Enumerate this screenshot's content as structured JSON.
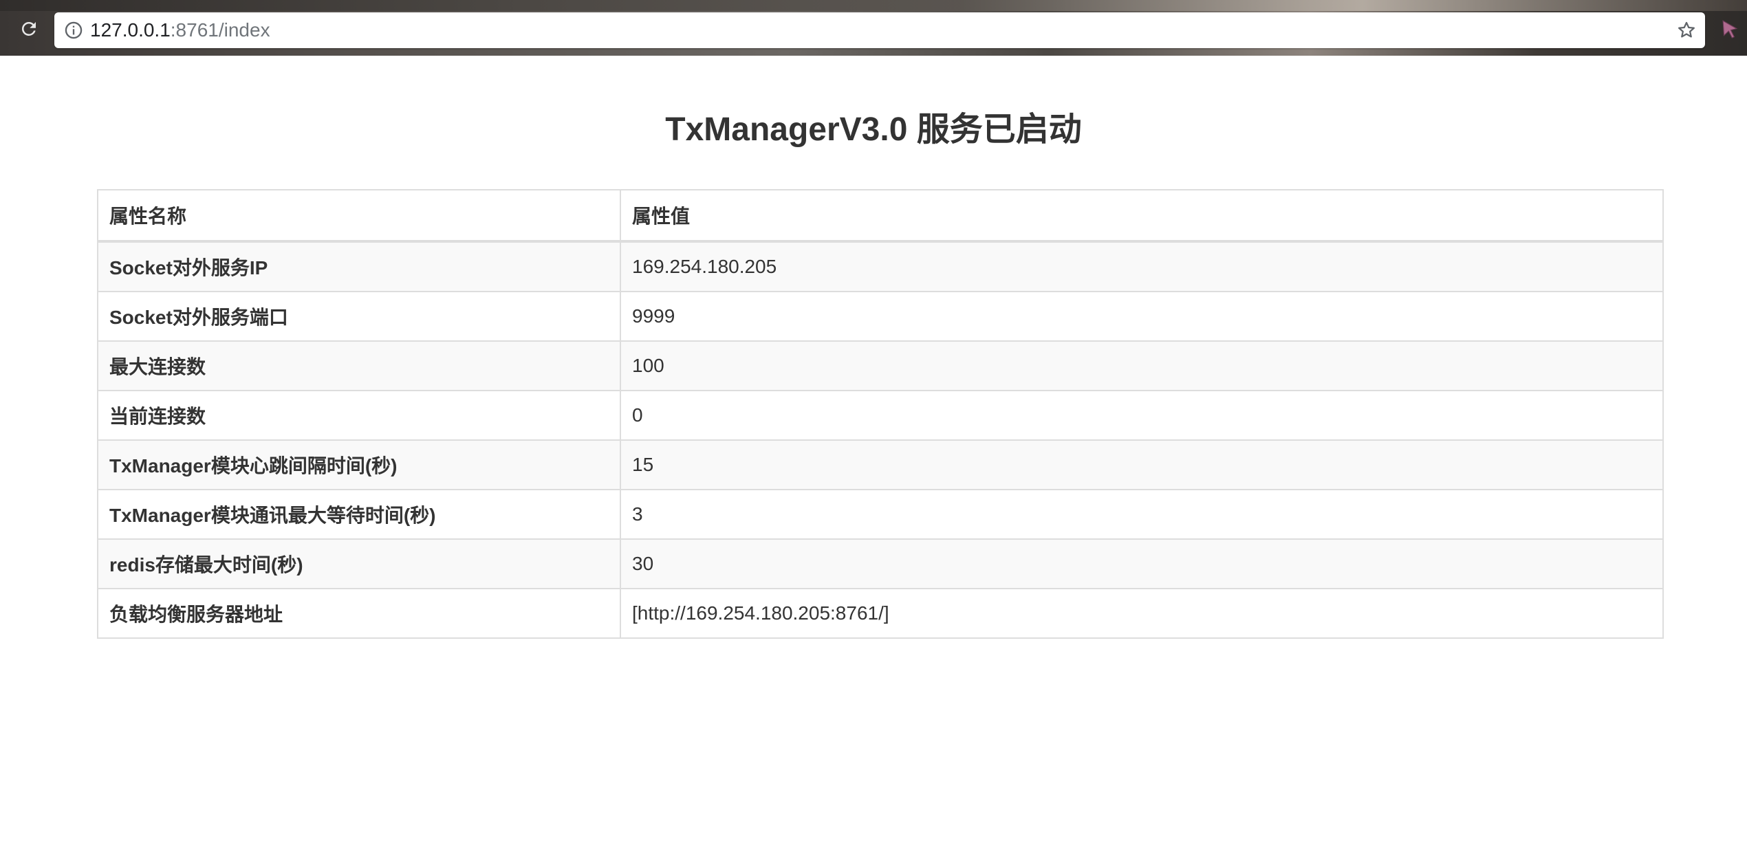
{
  "browser": {
    "url_host": "127.0.0.1",
    "url_rest": ":8761/index"
  },
  "page": {
    "title": "TxManagerV3.0 服务已启动"
  },
  "table": {
    "headers": [
      "属性名称",
      "属性值"
    ],
    "rows": [
      {
        "name": "Socket对外服务IP",
        "value": "169.254.180.205"
      },
      {
        "name": "Socket对外服务端口",
        "value": "9999"
      },
      {
        "name": "最大连接数",
        "value": "100"
      },
      {
        "name": "当前连接数",
        "value": "0"
      },
      {
        "name": "TxManager模块心跳间隔时间(秒)",
        "value": "15"
      },
      {
        "name": "TxManager模块通讯最大等待时间(秒)",
        "value": "3"
      },
      {
        "name": "redis存储最大时间(秒)",
        "value": "30"
      },
      {
        "name": "负载均衡服务器地址",
        "value": "[http://169.254.180.205:8761/]"
      }
    ]
  },
  "icons": {
    "reload": "reload-icon",
    "info": "info-icon",
    "bookmark": "star-icon",
    "extension": "cursor-extension-icon"
  }
}
